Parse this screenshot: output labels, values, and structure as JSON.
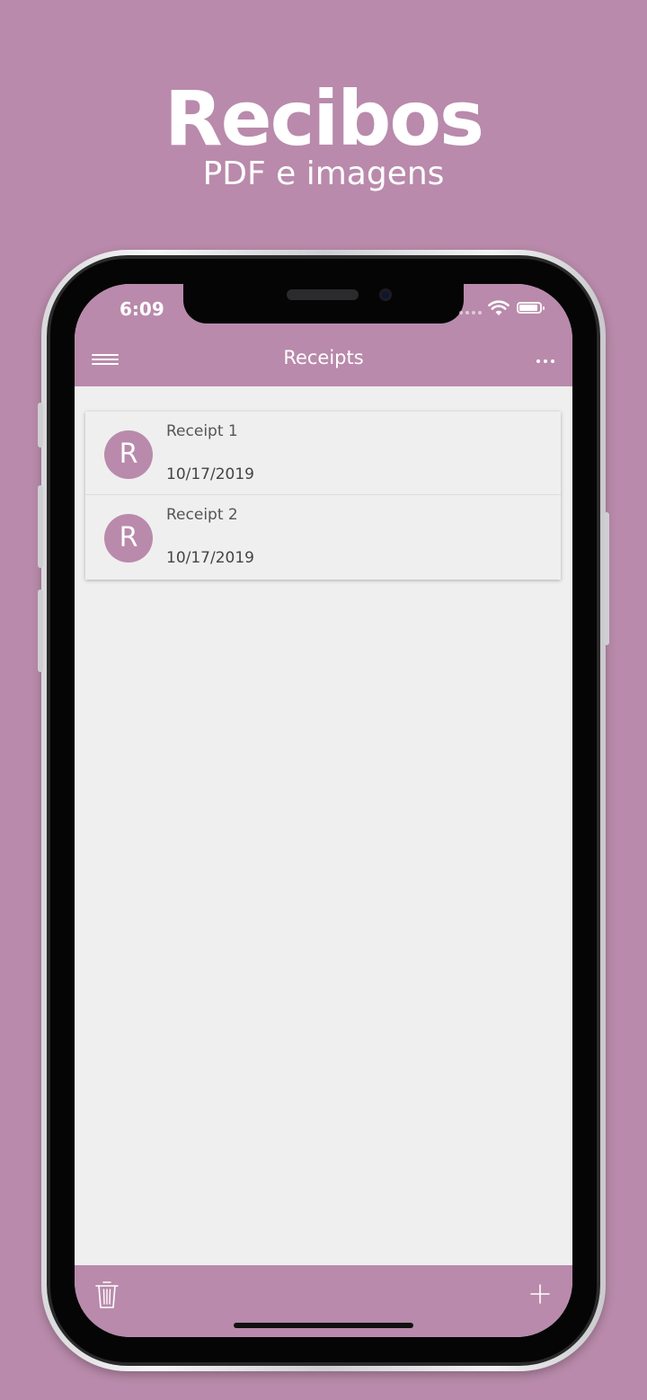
{
  "promo": {
    "title": "Recibos",
    "subtitle": "PDF e imagens"
  },
  "status_bar": {
    "time": "6:09"
  },
  "nav_bar": {
    "title": "Receipts",
    "menu_icon": "hamburger-menu-icon",
    "more_icon": "more-horizontal-icon"
  },
  "receipts": [
    {
      "avatar_letter": "R",
      "name": "Receipt 1",
      "date": "10/17/2019"
    },
    {
      "avatar_letter": "R",
      "name": "Receipt 2",
      "date": "10/17/2019"
    }
  ],
  "toolbar": {
    "delete_icon": "trash-icon",
    "add_icon": "plus-icon"
  },
  "colors": {
    "accent": "#b98aab",
    "background": "#efefef"
  }
}
